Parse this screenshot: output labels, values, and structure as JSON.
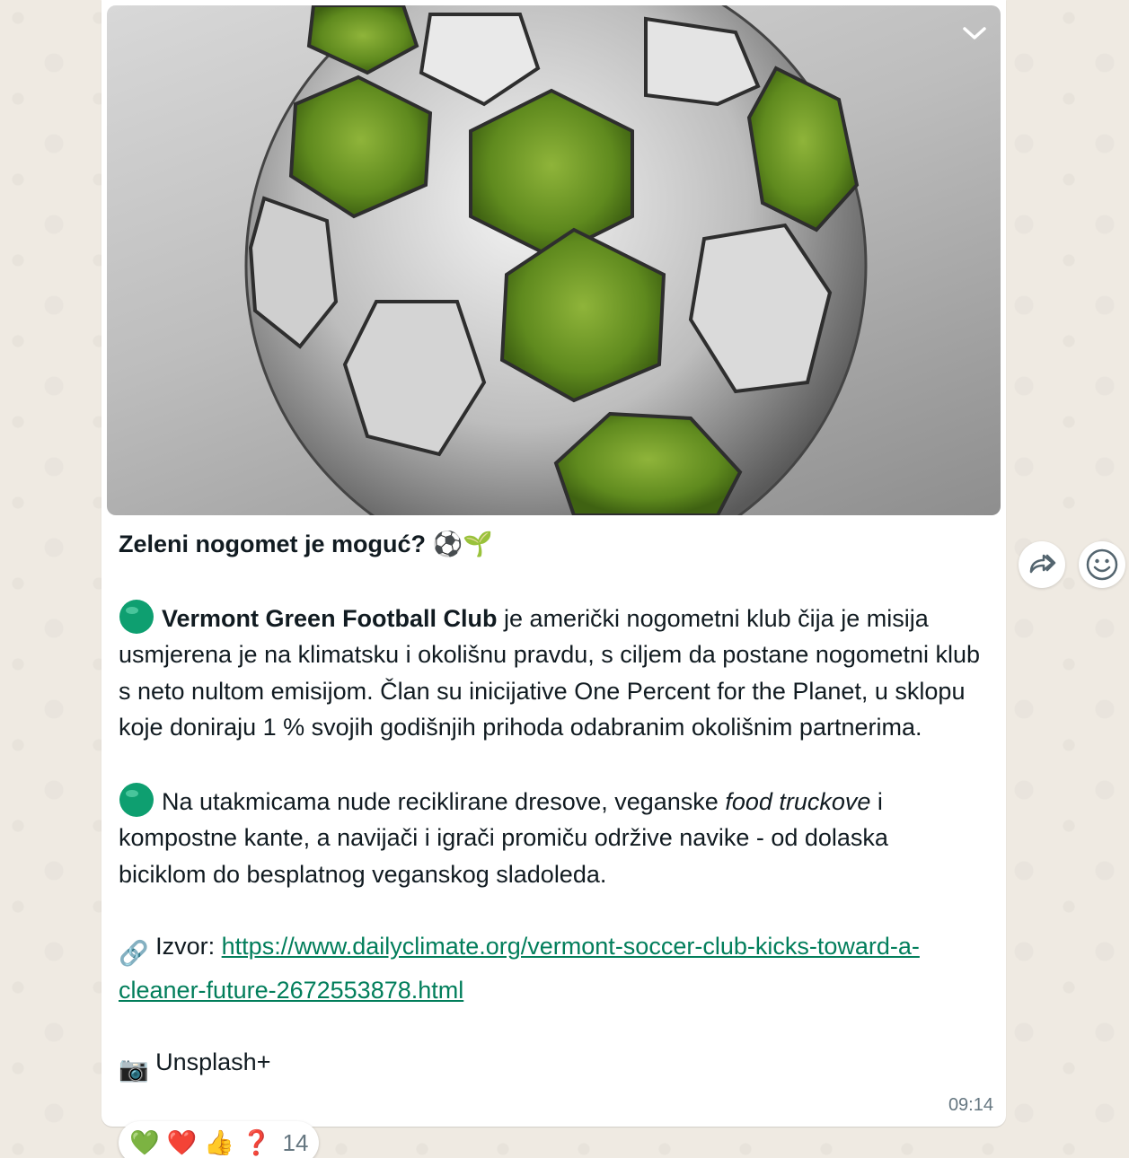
{
  "message": {
    "title": "Zeleni nogomet je moguć? ⚽🌱",
    "para1_bold": "Vermont Green Football Club",
    "para1_rest": " je američki nogometni klub čija je misija usmjerena je na klimatsku i okolišnu pravdu, s ciljem da postane nogometni klub s neto nultom emisijom. Član su inicijative One Percent for the Planet, u sklopu koje doniraju 1 % svojih godišnjih prihoda odabranim okolišnim partnerima.",
    "para2_start": "Na utakmicama nude reciklirane dresove, veganske ",
    "para2_italic": "food truckove",
    "para2_end": " i kompostne kante, a navijači i igrači promiču održive navike - od dolaska biciklom do besplatnog veganskog sladoleda.",
    "source_icon": "🔗",
    "source_label": "Izvor: ",
    "source_url": "https://www.dailyclimate.org/vermont-soccer-club-kicks-toward-a-cleaner-future-2672553878.html",
    "photo_icon": "📷",
    "photo_credit": "Unsplash+",
    "time": "09:14"
  },
  "reactions": {
    "emojis": [
      "💚",
      "❤️",
      "👍",
      "❓"
    ],
    "count": "14"
  },
  "icons": {
    "bullet": "green-circle-icon",
    "menu": "chevron-down-icon",
    "forward": "forward-icon",
    "react": "smiley-icon"
  },
  "colors": {
    "link": "#027e5b",
    "bubble": "#ffffff",
    "background": "#efeae2",
    "time": "#667781"
  }
}
